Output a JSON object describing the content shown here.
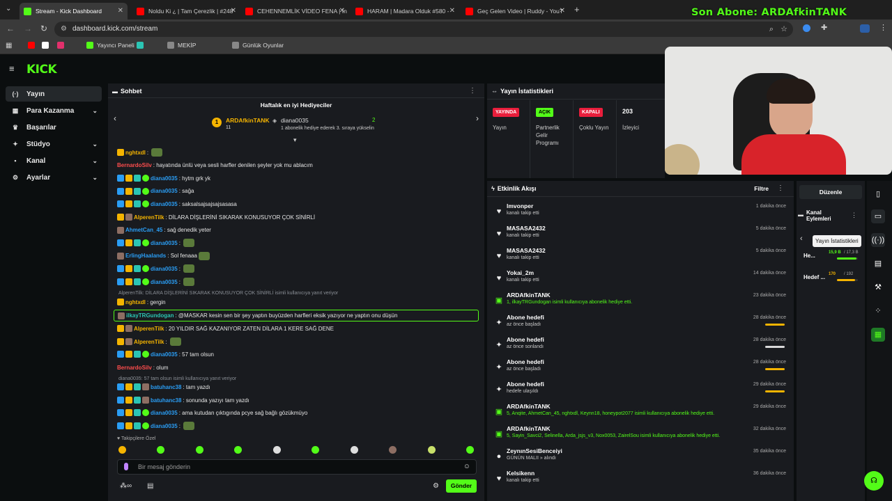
{
  "tabs": [
    {
      "label": "Stream - Kick Dashboard",
      "color": "#53fc18",
      "active": true
    },
    {
      "label": "Noldu Ki ¿ | Tam Çerezlik | #248",
      "color": "#ff0000"
    },
    {
      "label": "CEHENNEMLİK VİDEO FENA | İn",
      "color": "#ff0000"
    },
    {
      "label": "HARAM | Madara Olduk #580 -",
      "color": "#ff0000"
    },
    {
      "label": "Geç Gelen Video | Ruddy - YouT",
      "color": "#ff0000"
    }
  ],
  "overlay": {
    "last_sub": "Son Abone: ARDAfkinTANK"
  },
  "address": {
    "url": "dashboard.kick.com/stream"
  },
  "bookmarks": [
    {
      "label": "",
      "color": "#ff0000"
    },
    {
      "label": "",
      "color": "#ffffff"
    },
    {
      "label": "",
      "color": "#e1306c"
    },
    {
      "label": "Yayıncı Paneli",
      "color": "#53fc18"
    },
    {
      "label": "",
      "color": "#2bc5b4"
    },
    {
      "label": "MEKİP",
      "color": "#888888"
    },
    {
      "label": "Günlük Oyunlar",
      "color": "#888888"
    }
  ],
  "sidebar": {
    "logo": "KICK",
    "items": [
      {
        "label": "Yayın",
        "icon": "broadcast-icon",
        "glyph": "(·)",
        "active": true
      },
      {
        "label": "Para Kazanma",
        "icon": "money-icon",
        "glyph": "▦",
        "chevron": true
      },
      {
        "label": "Başarılar",
        "icon": "trophy-icon",
        "glyph": "♛"
      },
      {
        "label": "Stüdyo",
        "icon": "studio-icon",
        "glyph": "✦",
        "chevron": true
      },
      {
        "label": "Kanal",
        "icon": "channel-icon",
        "glyph": "▪",
        "chevron": true
      },
      {
        "label": "Ayarlar",
        "icon": "settings-icon",
        "glyph": "⚙",
        "chevron": true
      }
    ]
  },
  "chat": {
    "title": "Sohbet",
    "gifters_title": "Haftalık en iyi Hediyeciler",
    "top_gifter": {
      "name": "ARDAfkinTANK",
      "count": "11",
      "rank": "1"
    },
    "second_gifter": {
      "name": "diana0035",
      "count": "2",
      "note": "1 abonelik hediye ederek 3. sıraya yükselin"
    },
    "messages": [
      {
        "user": "nghtxdl",
        "color": "#f5b400",
        "text": "",
        "badges": [
          "gold"
        ],
        "emote": true
      },
      {
        "user": "BernardoSilv",
        "color": "#ff4d4d",
        "text": "hayatında ünlü veya sesli harfler denilen şeyler yok mu ablacım",
        "badges": []
      },
      {
        "user": "diana0035",
        "color": "#2a9df4",
        "text": "hytm grk yk",
        "badges": [
          "blue",
          "gold",
          "teal",
          "green"
        ]
      },
      {
        "user": "diana0035",
        "color": "#2a9df4",
        "text": "sağa",
        "badges": [
          "blue",
          "gold",
          "teal",
          "green"
        ]
      },
      {
        "user": "diana0035",
        "color": "#2a9df4",
        "text": "saksalsajsajsajsasasa",
        "badges": [
          "blue",
          "gold",
          "teal",
          "green"
        ]
      },
      {
        "user": "AlperenTilk",
        "color": "#f5b400",
        "text": "DİLARA DİŞLERİNİ SIKARAK KONUSUYOR ÇOK SİNİRLİ",
        "badges": [
          "gold",
          "mod"
        ]
      },
      {
        "user": "AhmetCan_45",
        "color": "#2a9df4",
        "text": "sağ denedik yeter",
        "badges": [
          "mod"
        ]
      },
      {
        "user": "diana0035",
        "color": "#2a9df4",
        "text": "",
        "badges": [
          "blue",
          "gold",
          "teal",
          "green"
        ],
        "emote": true
      },
      {
        "user": "ErlingHaalands",
        "color": "#2a9df4",
        "text": "Sol fenaaa",
        "badges": [
          "mod"
        ],
        "emote": true
      },
      {
        "user": "diana0035",
        "color": "#2a9df4",
        "text": "",
        "badges": [
          "blue",
          "gold",
          "teal",
          "green"
        ],
        "emote": true
      },
      {
        "user": "diana0035",
        "color": "#2a9df4",
        "text": "",
        "badges": [
          "blue",
          "gold",
          "teal",
          "green"
        ],
        "emote": true
      }
    ],
    "reply1": "AlperenTilk: DİLARA DİŞLERİNİ SIKARAK KONUSUYOR ÇOK SİNİRLİ isimli kullanıcıya yanıt veriyor",
    "messages2": [
      {
        "user": "nghtxdl",
        "color": "#f5b400",
        "text": "gergin",
        "badges": [
          "gold"
        ]
      },
      {
        "user": "ilkayTRGundogan",
        "color": "#2bc5b4",
        "text": "@MASKAR kesin sen bir şey yaptın buyüzden harfleri eksik yazıyor ne yaptın onu düşün",
        "badges": [
          "mod"
        ],
        "highlight": true
      },
      {
        "user": "AlperenTilk",
        "color": "#f5b400",
        "text": "20 YILDIR SAĞ KAZANIYOR ZATEN DİLARA 1 KERE SAĞ DENE",
        "badges": [
          "gold",
          "mod"
        ]
      },
      {
        "user": "AlperenTilk",
        "color": "#f5b400",
        "text": "",
        "badges": [
          "gold",
          "mod"
        ],
        "emote": true
      },
      {
        "user": "diana0035",
        "color": "#2a9df4",
        "text": "57 tam olsun",
        "badges": [
          "blue",
          "gold",
          "teal",
          "green"
        ]
      },
      {
        "user": "BernardoSilv",
        "color": "#ff4d4d",
        "text": "olum",
        "badges": []
      }
    ],
    "reply2": "diana0035: 57 tam olsun isimli kullanıcıya yanıt veriyor",
    "messages3": [
      {
        "user": "batuhanc38",
        "color": "#2a9df4",
        "text": "tam yazdı",
        "badges": [
          "blue",
          "gold",
          "teal",
          "mod"
        ]
      },
      {
        "user": "batuhanc38",
        "color": "#2a9df4",
        "text": "sonunda yazıyı tam yazdı",
        "badges": [
          "blue",
          "gold",
          "teal",
          "mod"
        ]
      },
      {
        "user": "diana0035",
        "color": "#2a9df4",
        "text": "ama kutudan çıktıgında pcye sağ bağlı gözükmüyo",
        "badges": [
          "blue",
          "gold",
          "teal",
          "green"
        ]
      },
      {
        "user": "diana0035",
        "color": "#2a9df4",
        "text": "",
        "badges": [
          "blue",
          "gold",
          "teal",
          "green"
        ],
        "emote": true
      }
    ],
    "followers_only": "Takipçilere Özel",
    "input_placeholder": "Bir mesaj gönderin",
    "send_label": "Gönder"
  },
  "stats": {
    "title": "Yayın İstatistikleri",
    "items": [
      {
        "badge": "YAYINDA",
        "badge_color": "#e91e3c",
        "badge_text_color": "#ffffff",
        "label": "Yayın"
      },
      {
        "badge": "AÇIK",
        "badge_color": "#53fc18",
        "badge_text_color": "#000000",
        "label": "Partnerlik Gelir Programı"
      },
      {
        "badge": "KAPALI",
        "badge_color": "#e91e3c",
        "badge_text_color": "#ffffff",
        "label": "Çoklu Yayın"
      },
      {
        "badge": "203",
        "badge_color": "transparent",
        "badge_text_color": "#ffffff",
        "label": "İzleyici"
      }
    ]
  },
  "activity": {
    "title": "Etkinlik Akışı",
    "filter": "Filtre",
    "events": [
      {
        "name": "lmvonper",
        "sub": "kanalı takip etti",
        "time": "1 dakika önce",
        "icon": "heart-icon",
        "glyph": "♥"
      },
      {
        "name": "MASASA2432",
        "sub": "kanalı takip etti",
        "time": "5 dakika önce",
        "icon": "heart-icon",
        "glyph": "♥"
      },
      {
        "name": "MASASA2432",
        "sub": "kanalı takip etti",
        "time": "5 dakika önce",
        "icon": "heart-icon",
        "glyph": "♥"
      },
      {
        "name": "Yokai_2m",
        "sub": "kanalı takip etti",
        "time": "14 dakika önce",
        "icon": "heart-icon",
        "glyph": "♥"
      },
      {
        "name": "ARDAfkinTANK",
        "sub": "1, ilkayTRGundogan isimli kullanıcıya abonelik hediye etti.",
        "time": "23 dakika önce",
        "icon": "gift-icon",
        "glyph": "▣",
        "green": true
      },
      {
        "name": "Abone hedefi",
        "sub": "az önce başladı",
        "time": "28 dakika önce",
        "icon": "sparkle-icon",
        "glyph": "✦",
        "bar": "#f5b400"
      },
      {
        "name": "Abone hedefi",
        "sub": "az önce sonlandı",
        "time": "28 dakika önce",
        "icon": "sparkle-icon",
        "glyph": "✦",
        "bar": "#d9d9d9"
      },
      {
        "name": "Abone hedefi",
        "sub": "az önce başladı",
        "time": "28 dakika önce",
        "icon": "sparkle-icon",
        "glyph": "✦",
        "bar": "#f5b400"
      },
      {
        "name": "Abone hedefi",
        "sub": "hedefe ulaşıldı",
        "time": "29 dakika önce",
        "icon": "sparkle-icon",
        "glyph": "✦",
        "bar": "#f5b400"
      },
      {
        "name": "ARDAfkinTANK",
        "sub": "5, Anqite, AhmetCan_45, nghtxdl, Keynn18, honeypot2077 isimli kullanıcıya abonelik hediye etti.",
        "time": "29 dakika önce",
        "icon": "gift-icon",
        "glyph": "▣",
        "green": true
      },
      {
        "name": "ARDAfkinTANK",
        "sub": "5, Sayin_Savci2, Selinella, Arda_jsjs_v3, Nox0053, ZairelSou isimli kullanıcıya abonelik hediye etti.",
        "time": "32 dakika önce",
        "icon": "gift-icon",
        "glyph": "▣",
        "green": true
      },
      {
        "name": "ZeynınSesiBenceiyi",
        "sub": "GÜNÜN MALII » alındı",
        "time": "35 dakika önce",
        "icon": "points-icon",
        "glyph": "●"
      },
      {
        "name": "Kelsikenn",
        "sub": "kanalı takip etti",
        "time": "36 dakika önce",
        "icon": "heart-icon",
        "glyph": "♥"
      }
    ]
  },
  "right": {
    "edit_label": "Düzenle",
    "actions_title": "Kanal Eylemleri",
    "tooltip": "Yayın İstatistikleri",
    "goals": [
      {
        "label": "Hе...",
        "value": "15,9 B",
        "target": "/ 17,3 B",
        "progress": 0.92,
        "color": "#53fc18"
      },
      {
        "label": "Hedef ...",
        "value": "170",
        "target": "/ 192",
        "progress": 0.88,
        "color": "#f5b400"
      }
    ]
  }
}
